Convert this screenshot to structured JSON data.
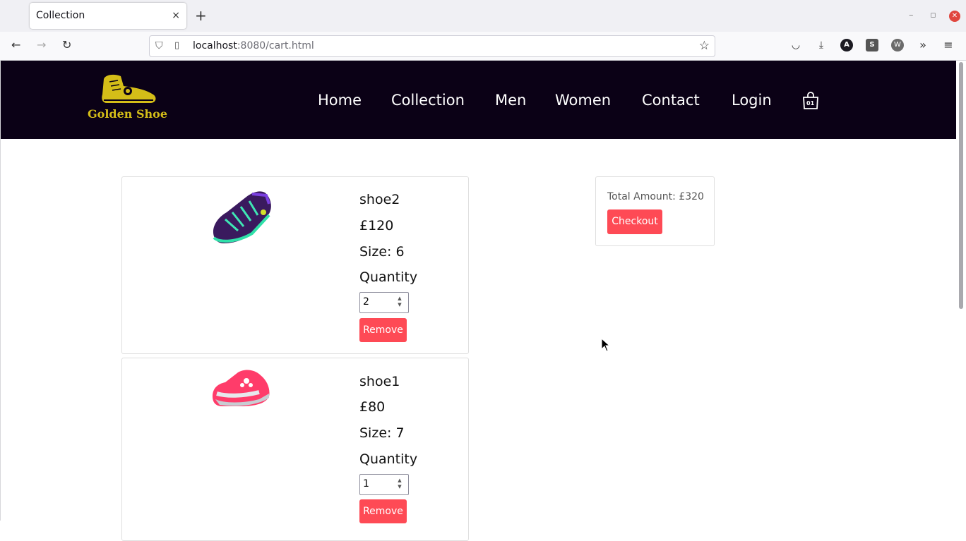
{
  "browser": {
    "tab_title": "Collection",
    "tab_close": "×",
    "new_tab": "+",
    "url_host": "localhost",
    "url_rest": ":8080/cart.html",
    "icons": [
      "back-icon",
      "forward-icon",
      "reload-icon",
      "shield-icon",
      "page-icon",
      "star-icon",
      "pocket-icon",
      "download-icon",
      "account-icon",
      "extension-s-icon",
      "extension-w-icon",
      "overflow-icon",
      "menu-icon"
    ],
    "toolbar_account_letter": "A",
    "toolbar_ext_s_letter": "S",
    "toolbar_ext_w_letter": "W"
  },
  "site": {
    "logo_text": "Golden Shoe",
    "brand_color": "#d4bd18",
    "header_bg": "#0b0116",
    "nav": [
      "Home",
      "Collection",
      "Men",
      "Women",
      "Contact",
      "Login"
    ],
    "cart_count": "01"
  },
  "cart": {
    "items": [
      {
        "name": "shoe2",
        "price": "£120",
        "size": "Size: 6",
        "quantity_label": "Quantity",
        "quantity": "2",
        "remove_label": "Remove"
      },
      {
        "name": "shoe1",
        "price": "£80",
        "size": "Size: 7",
        "quantity_label": "Quantity",
        "quantity": "1",
        "remove_label": "Remove"
      }
    ],
    "summary": {
      "total": "Total Amount: £320",
      "checkout_label": "Checkout"
    },
    "accent_color": "#fe4a55"
  }
}
